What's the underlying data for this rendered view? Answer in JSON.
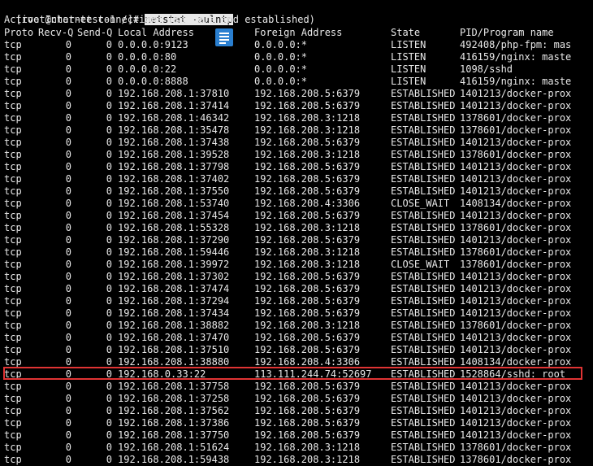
{
  "terminal": {
    "prompt": "[root@chat-test-1 /]# ",
    "command": "netstat -aulntp",
    "title_line": "Active Internet connections (servers and established)"
  },
  "columns": [
    "Proto",
    "Recv-Q",
    "Send-Q",
    "Local Address",
    "Foreign Address",
    "State",
    "PID/Program name"
  ],
  "rows": [
    [
      "tcp",
      "0",
      "0",
      "0.0.0.0:9123",
      "0.0.0.0:*",
      "LISTEN",
      "492408/php-fpm: mas"
    ],
    [
      "tcp",
      "0",
      "0",
      "0.0.0.0:80",
      "0.0.0.0:*",
      "LISTEN",
      "416159/nginx: maste"
    ],
    [
      "tcp",
      "0",
      "0",
      "0.0.0.0:22",
      "0.0.0.0:*",
      "LISTEN",
      "1098/sshd"
    ],
    [
      "tcp",
      "0",
      "0",
      "0.0.0.0:8888",
      "0.0.0.0:*",
      "LISTEN",
      "416159/nginx: maste"
    ],
    [
      "tcp",
      "0",
      "0",
      "192.168.208.1:37810",
      "192.168.208.5:6379",
      "ESTABLISHED",
      "1401213/docker-prox"
    ],
    [
      "tcp",
      "0",
      "0",
      "192.168.208.1:37414",
      "192.168.208.5:6379",
      "ESTABLISHED",
      "1401213/docker-prox"
    ],
    [
      "tcp",
      "0",
      "0",
      "192.168.208.1:46342",
      "192.168.208.3:1218",
      "ESTABLISHED",
      "1378601/docker-prox"
    ],
    [
      "tcp",
      "0",
      "0",
      "192.168.208.1:35478",
      "192.168.208.3:1218",
      "ESTABLISHED",
      "1378601/docker-prox"
    ],
    [
      "tcp",
      "0",
      "0",
      "192.168.208.1:37438",
      "192.168.208.5:6379",
      "ESTABLISHED",
      "1401213/docker-prox"
    ],
    [
      "tcp",
      "0",
      "0",
      "192.168.208.1:39528",
      "192.168.208.3:1218",
      "ESTABLISHED",
      "1378601/docker-prox"
    ],
    [
      "tcp",
      "0",
      "0",
      "192.168.208.1:37798",
      "192.168.208.5:6379",
      "ESTABLISHED",
      "1401213/docker-prox"
    ],
    [
      "tcp",
      "0",
      "0",
      "192.168.208.1:37402",
      "192.168.208.5:6379",
      "ESTABLISHED",
      "1401213/docker-prox"
    ],
    [
      "tcp",
      "0",
      "0",
      "192.168.208.1:37550",
      "192.168.208.5:6379",
      "ESTABLISHED",
      "1401213/docker-prox"
    ],
    [
      "tcp",
      "0",
      "0",
      "192.168.208.1:53740",
      "192.168.208.4:3306",
      "CLOSE_WAIT",
      "1408134/docker-prox"
    ],
    [
      "tcp",
      "0",
      "0",
      "192.168.208.1:37454",
      "192.168.208.5:6379",
      "ESTABLISHED",
      "1401213/docker-prox"
    ],
    [
      "tcp",
      "0",
      "0",
      "192.168.208.1:55328",
      "192.168.208.3:1218",
      "ESTABLISHED",
      "1378601/docker-prox"
    ],
    [
      "tcp",
      "0",
      "0",
      "192.168.208.1:37290",
      "192.168.208.5:6379",
      "ESTABLISHED",
      "1401213/docker-prox"
    ],
    [
      "tcp",
      "0",
      "0",
      "192.168.208.1:59446",
      "192.168.208.3:1218",
      "ESTABLISHED",
      "1378601/docker-prox"
    ],
    [
      "tcp",
      "0",
      "0",
      "192.168.208.1:39972",
      "192.168.208.3:1218",
      "CLOSE_WAIT",
      "1378601/docker-prox"
    ],
    [
      "tcp",
      "0",
      "0",
      "192.168.208.1:37302",
      "192.168.208.5:6379",
      "ESTABLISHED",
      "1401213/docker-prox"
    ],
    [
      "tcp",
      "0",
      "0",
      "192.168.208.1:37474",
      "192.168.208.5:6379",
      "ESTABLISHED",
      "1401213/docker-prox"
    ],
    [
      "tcp",
      "0",
      "0",
      "192.168.208.1:37294",
      "192.168.208.5:6379",
      "ESTABLISHED",
      "1401213/docker-prox"
    ],
    [
      "tcp",
      "0",
      "0",
      "192.168.208.1:37434",
      "192.168.208.5:6379",
      "ESTABLISHED",
      "1401213/docker-prox"
    ],
    [
      "tcp",
      "0",
      "0",
      "192.168.208.1:38882",
      "192.168.208.3:1218",
      "ESTABLISHED",
      "1378601/docker-prox"
    ],
    [
      "tcp",
      "0",
      "0",
      "192.168.208.1:37470",
      "192.168.208.5:6379",
      "ESTABLISHED",
      "1401213/docker-prox"
    ],
    [
      "tcp",
      "0",
      "0",
      "192.168.208.1:37510",
      "192.168.208.5:6379",
      "ESTABLISHED",
      "1401213/docker-prox"
    ],
    [
      "tcp",
      "0",
      "0",
      "192.168.208.1:38880",
      "192.168.208.4:3306",
      "ESTABLISHED",
      "1408134/docker-prox"
    ],
    [
      "tcp",
      "0",
      "0",
      "192.168.0.33:22",
      "113.111.244.74:52697",
      "ESTABLISHED",
      "1528864/sshd: root"
    ],
    [
      "tcp",
      "0",
      "0",
      "192.168.208.1:37758",
      "192.168.208.5:6379",
      "ESTABLISHED",
      "1401213/docker-prox"
    ],
    [
      "tcp",
      "0",
      "0",
      "192.168.208.1:37258",
      "192.168.208.5:6379",
      "ESTABLISHED",
      "1401213/docker-prox"
    ],
    [
      "tcp",
      "0",
      "0",
      "192.168.208.1:37562",
      "192.168.208.5:6379",
      "ESTABLISHED",
      "1401213/docker-prox"
    ],
    [
      "tcp",
      "0",
      "0",
      "192.168.208.1:37386",
      "192.168.208.5:6379",
      "ESTABLISHED",
      "1401213/docker-prox"
    ],
    [
      "tcp",
      "0",
      "0",
      "192.168.208.1:37750",
      "192.168.208.5:6379",
      "ESTABLISHED",
      "1401213/docker-prox"
    ],
    [
      "tcp",
      "0",
      "0",
      "192.168.208.1:51624",
      "192.168.208.3:1218",
      "ESTABLISHED",
      "1378601/docker-prox"
    ],
    [
      "tcp",
      "0",
      "0",
      "192.168.208.1:59438",
      "192.168.208.3:1218",
      "ESTABLISHED",
      "1378601/docker-prox"
    ]
  ],
  "highlight_row_index": 27,
  "highlight_color": "#e03434",
  "icon": "document-icon"
}
